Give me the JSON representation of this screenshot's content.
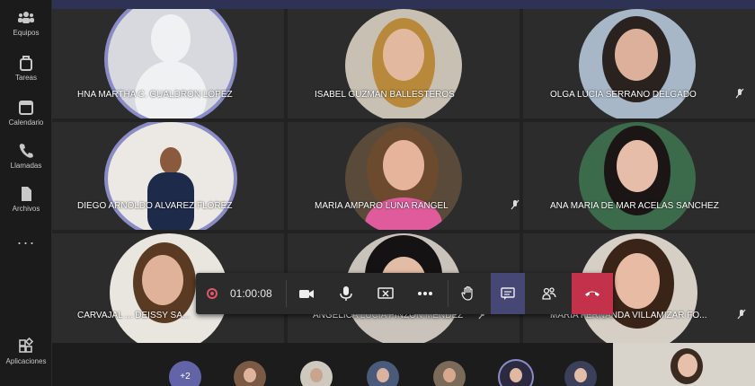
{
  "rail": {
    "items": [
      {
        "label": "Equipos",
        "icon": "teams-icon"
      },
      {
        "label": "Tareas",
        "icon": "assignments-icon"
      },
      {
        "label": "Calendario",
        "icon": "calendar-icon"
      },
      {
        "label": "Llamadas",
        "icon": "phone-icon"
      },
      {
        "label": "Archivos",
        "icon": "files-icon"
      },
      {
        "label": "Aplicaciones",
        "icon": "apps-icon"
      }
    ],
    "more": "···"
  },
  "participants": [
    {
      "name": "HNA MARTHA C. GUALDRON LOPEZ",
      "muted": false
    },
    {
      "name": "ISABEL GUZMAN BALLESTEROS",
      "muted": false
    },
    {
      "name": "OLGA LUCIA SERRANO DELGADO",
      "muted": true
    },
    {
      "name": "DIEGO ARNOLDO ALVAREZ FLOREZ",
      "muted": false
    },
    {
      "name": "MARIA AMPARO LUNA RANGEL",
      "muted": true
    },
    {
      "name": "ANA MARIA DE MAR ACELAS SANCHEZ",
      "muted": false
    },
    {
      "name": "CARVAJAL ... DEISSY SA...",
      "muted": false
    },
    {
      "name": "ANGELICA LUCIA PINZON MENDEZ",
      "muted": true
    },
    {
      "name": "MARIA FERNANDA VILLAMIZAR FO...",
      "muted": true
    }
  ],
  "controls": {
    "timer": "01:00:08"
  },
  "overflow": {
    "count_label": "+2"
  },
  "colors": {
    "accent": "#6264a7",
    "hangup": "#c4314b",
    "ring": "#8b8cc7"
  }
}
